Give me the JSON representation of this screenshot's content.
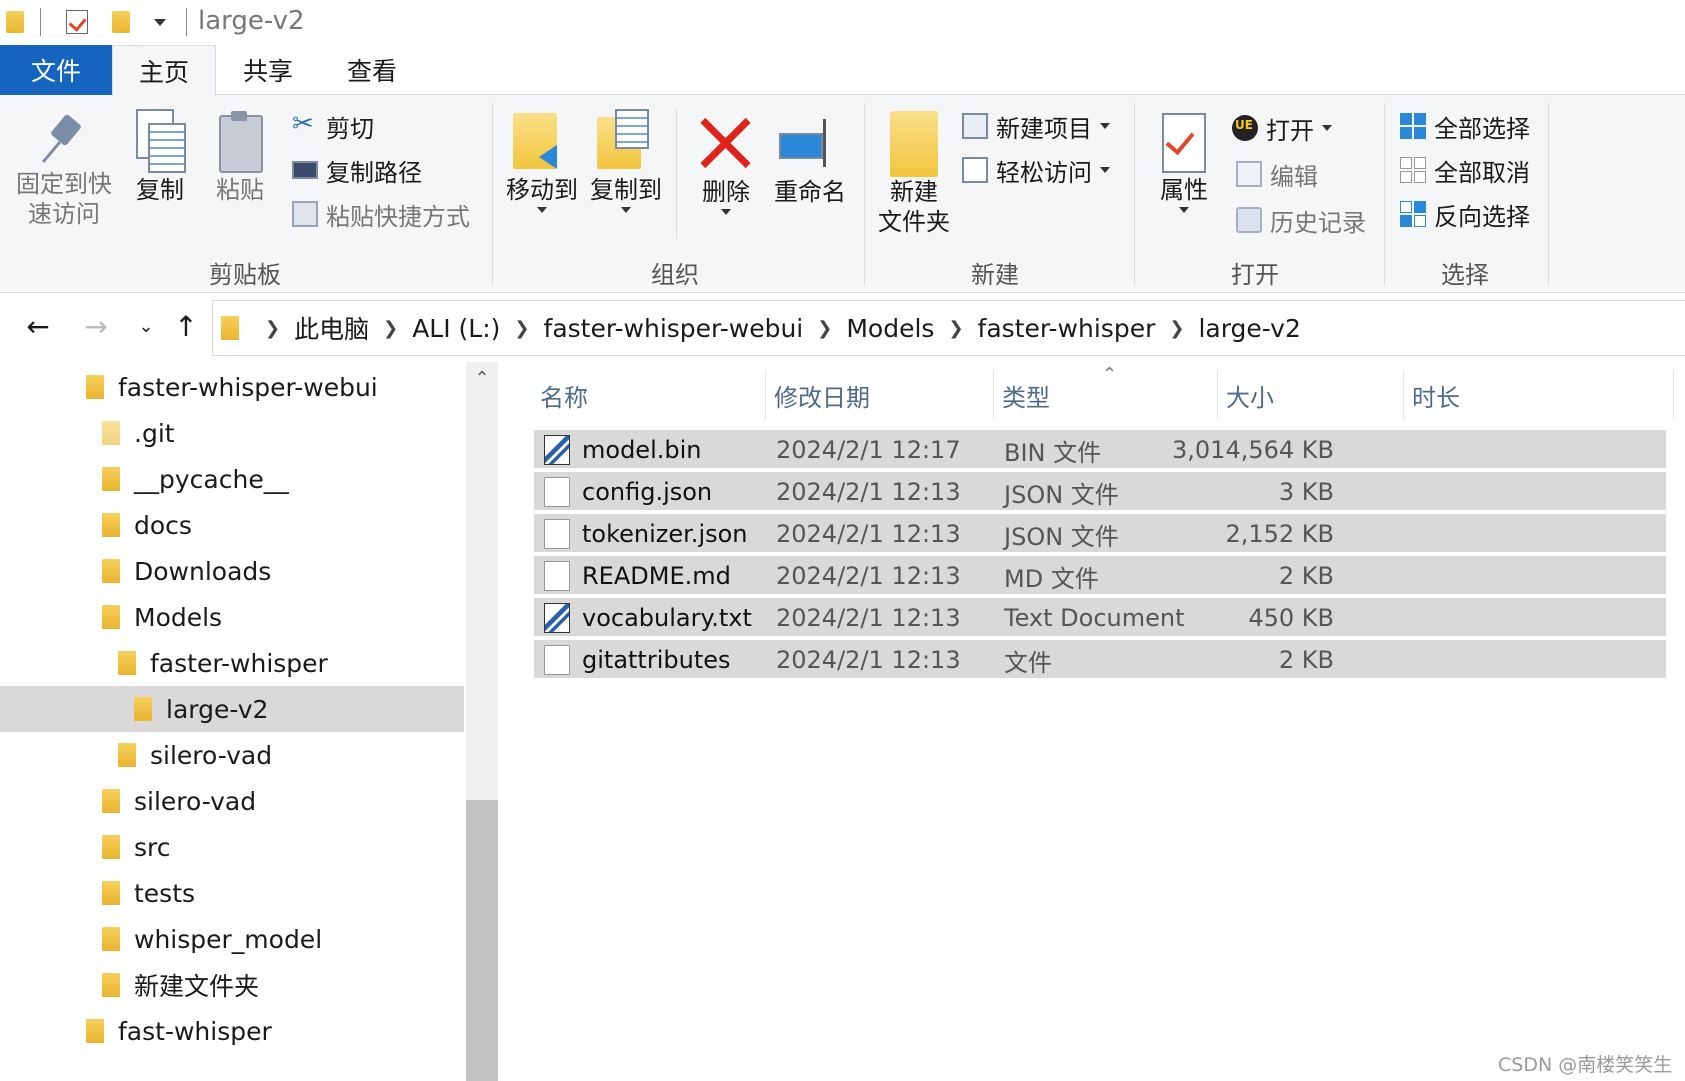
{
  "title": {
    "text": "large-v2"
  },
  "ribbon_tabs": [
    "文件",
    "主页",
    "共享",
    "查看"
  ],
  "clipboard": {
    "pin_label_1": "固定到快",
    "pin_label_2": "速访问",
    "copy": "复制",
    "paste": "粘贴",
    "cut": "剪切",
    "copy_path": "复制路径",
    "paste_shortcut": "粘贴快捷方式",
    "group": "剪贴板"
  },
  "organize": {
    "move_to": "移动到",
    "copy_to": "复制到",
    "delete": "删除",
    "rename": "重命名",
    "group": "组织"
  },
  "new": {
    "new_folder_1": "新建",
    "new_folder_2": "文件夹",
    "new_item": "新建项目",
    "easy_access": "轻松访问",
    "group": "新建"
  },
  "open": {
    "properties": "属性",
    "open": "打开",
    "edit": "编辑",
    "history": "历史记录",
    "group": "打开"
  },
  "select": {
    "select_all": "全部选择",
    "select_none": "全部取消",
    "invert": "反向选择",
    "group": "选择"
  },
  "breadcrumb": [
    "此电脑",
    "ALI (L:)",
    "faster-whisper-webui",
    "Models",
    "faster-whisper",
    "large-v2"
  ],
  "tree": [
    {
      "label": "faster-whisper-webui",
      "level": 0
    },
    {
      "label": ".git",
      "level": 1
    },
    {
      "label": "__pycache__",
      "level": 1
    },
    {
      "label": "docs",
      "level": 1
    },
    {
      "label": "Downloads",
      "level": 1
    },
    {
      "label": "Models",
      "level": 1
    },
    {
      "label": "faster-whisper",
      "level": 2
    },
    {
      "label": "large-v2",
      "level": 3,
      "selected": true
    },
    {
      "label": "silero-vad",
      "level": 2
    },
    {
      "label": "silero-vad",
      "level": 1
    },
    {
      "label": "src",
      "level": 1
    },
    {
      "label": "tests",
      "level": 1
    },
    {
      "label": "whisper_model",
      "level": 1
    },
    {
      "label": "新建文件夹",
      "level": 1
    },
    {
      "label": "fast-whisper",
      "level": 0
    }
  ],
  "columns": [
    "名称",
    "修改日期",
    "类型",
    "大小",
    "时长"
  ],
  "files": [
    {
      "name": "model.bin",
      "date": "2024/2/1 12:17",
      "type": "BIN 文件",
      "size": "3,014,564 KB",
      "icon": "bin"
    },
    {
      "name": "config.json",
      "date": "2024/2/1 12:13",
      "type": "JSON 文件",
      "size": "3 KB",
      "icon": "doc"
    },
    {
      "name": "tokenizer.json",
      "date": "2024/2/1 12:13",
      "type": "JSON 文件",
      "size": "2,152 KB",
      "icon": "doc"
    },
    {
      "name": "README.md",
      "date": "2024/2/1 12:13",
      "type": "MD 文件",
      "size": "2 KB",
      "icon": "doc"
    },
    {
      "name": "vocabulary.txt",
      "date": "2024/2/1 12:13",
      "type": "Text Document",
      "size": "450 KB",
      "icon": "bin"
    },
    {
      "name": "gitattributes",
      "date": "2024/2/1 12:13",
      "type": "文件",
      "size": "2 KB",
      "icon": "doc"
    }
  ],
  "watermark": "CSDN @南楼笑笑生",
  "colors": {
    "file_tab": "#1565c0",
    "selection": "#d9d9d9",
    "folder": "#f2c53c",
    "delete_x": "#e0231b"
  }
}
